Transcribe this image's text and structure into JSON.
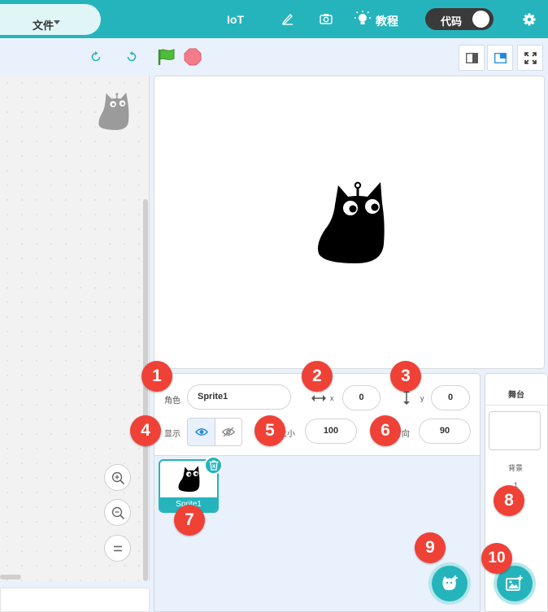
{
  "topbar": {
    "file_menu": "文件",
    "iot": "IoT",
    "tutorial": "教程",
    "code_toggle": "代码",
    "icons": [
      "pen-icon",
      "camera-icon",
      "lightbulb-icon",
      "gear-icon"
    ]
  },
  "subbar": {
    "icons": [
      "undo-icon",
      "redo-icon",
      "green-flag-icon",
      "stop-icon",
      "small-stage-icon",
      "large-stage-icon",
      "fullscreen-icon"
    ]
  },
  "sprite_info": {
    "sprite_label": "角色",
    "sprite_name": "Sprite1",
    "x_label": "x",
    "x_value": "0",
    "y_label": "y",
    "y_value": "0",
    "show_label": "显示",
    "size_label": "大小",
    "size_value": "100",
    "direction_label": "方向",
    "direction_value": "90"
  },
  "sprite_list": {
    "items": [
      {
        "name": "Sprite1"
      }
    ]
  },
  "stage_panel": {
    "title": "舞台",
    "backdrop_label": "背景",
    "backdrop_count": "1"
  },
  "callouts": [
    "1",
    "2",
    "3",
    "4",
    "5",
    "6",
    "7",
    "8",
    "9",
    "10"
  ],
  "colors": {
    "accent": "#25b4bc",
    "callout": "#ef4136",
    "toggle": "#3a3a3a"
  }
}
